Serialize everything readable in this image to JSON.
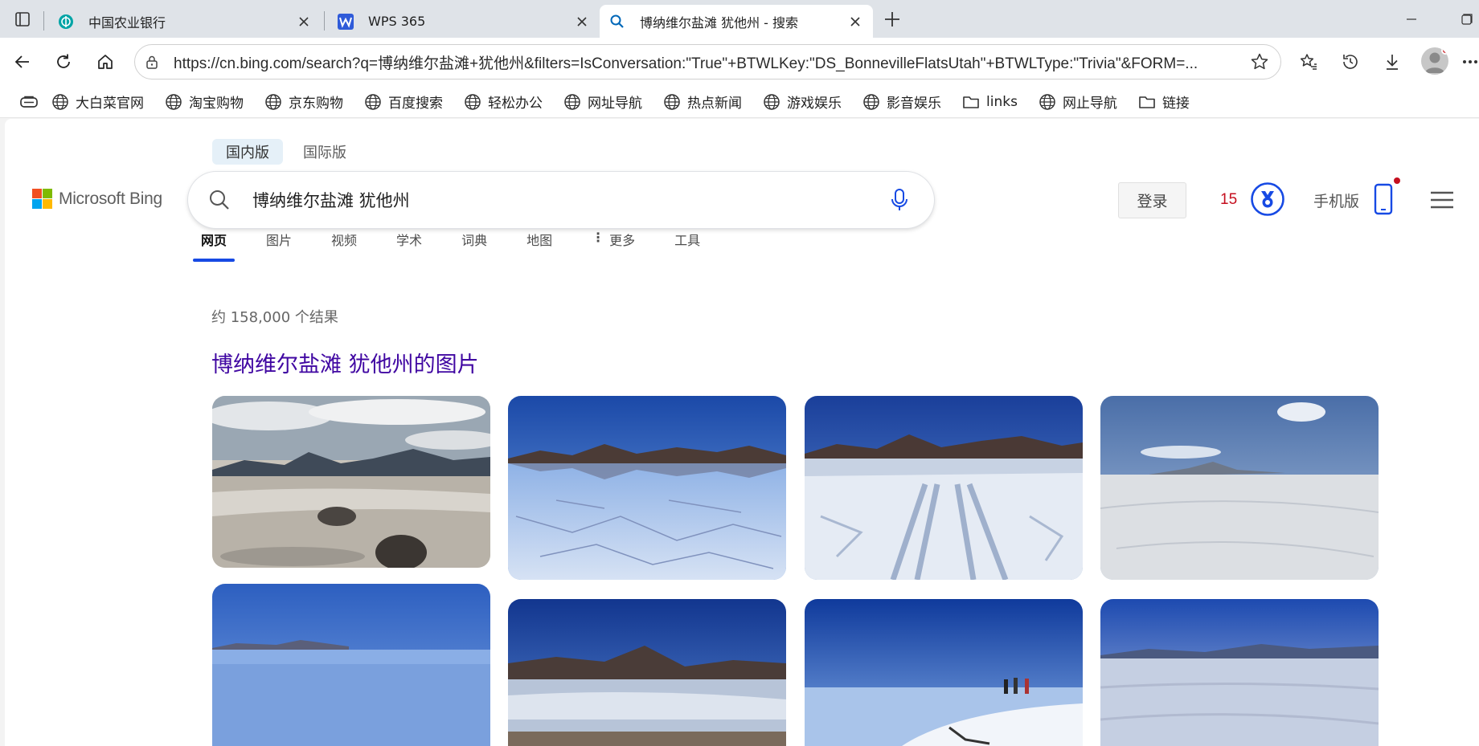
{
  "browser": {
    "tabs": [
      {
        "title": "中国农业银行",
        "favicon": "abc-bank-icon",
        "active": false
      },
      {
        "title": "WPS 365",
        "favicon": "wps-icon",
        "active": false
      },
      {
        "title": "博纳维尔盐滩 犹他州 - 搜索",
        "favicon": "search-icon",
        "active": true
      }
    ],
    "url": "https://cn.bing.com/search?q=博纳维尔盐滩+犹他州&filters=IsConversation:\"True\"+BTWLKey:\"DS_BonnevilleFlatsUtah\"+BTWLType:\"Trivia\"&FORM=...",
    "bookmarks": [
      {
        "label": "大白菜官网",
        "icon": "globe-icon"
      },
      {
        "label": "淘宝购物",
        "icon": "globe-icon"
      },
      {
        "label": "京东购物",
        "icon": "globe-icon"
      },
      {
        "label": "百度搜索",
        "icon": "globe-icon"
      },
      {
        "label": "轻松办公",
        "icon": "globe-icon"
      },
      {
        "label": "网址导航",
        "icon": "globe-icon"
      },
      {
        "label": "热点新闻",
        "icon": "globe-icon"
      },
      {
        "label": "游戏娱乐",
        "icon": "globe-icon"
      },
      {
        "label": "影音娱乐",
        "icon": "globe-icon"
      },
      {
        "label": "links",
        "icon": "folder-icon"
      },
      {
        "label": "网止导航",
        "icon": "globe-icon"
      },
      {
        "label": "链接",
        "icon": "folder-icon"
      }
    ]
  },
  "bing": {
    "region_tabs": [
      "国内版",
      "国际版"
    ],
    "logo_text": "Microsoft Bing",
    "query": "博纳维尔盐滩 犹他州",
    "signin_label": "登录",
    "rewards_points": "15",
    "mobile_label": "手机版",
    "vertical_tabs": [
      "网页",
      "图片",
      "视频",
      "学术",
      "词典",
      "地图",
      "更多",
      "工具"
    ],
    "result_count": "约 158,000 个结果",
    "images_heading": "博纳维尔盐滩 犹他州的图片",
    "colors": {
      "accent_blue": "#174ae4",
      "heading_purple": "#4007a2",
      "points_red": "#c50f1f",
      "ms_red": "#f25022",
      "ms_green": "#7fba00",
      "ms_blue": "#00a4ef",
      "ms_yellow": "#ffb900"
    }
  }
}
